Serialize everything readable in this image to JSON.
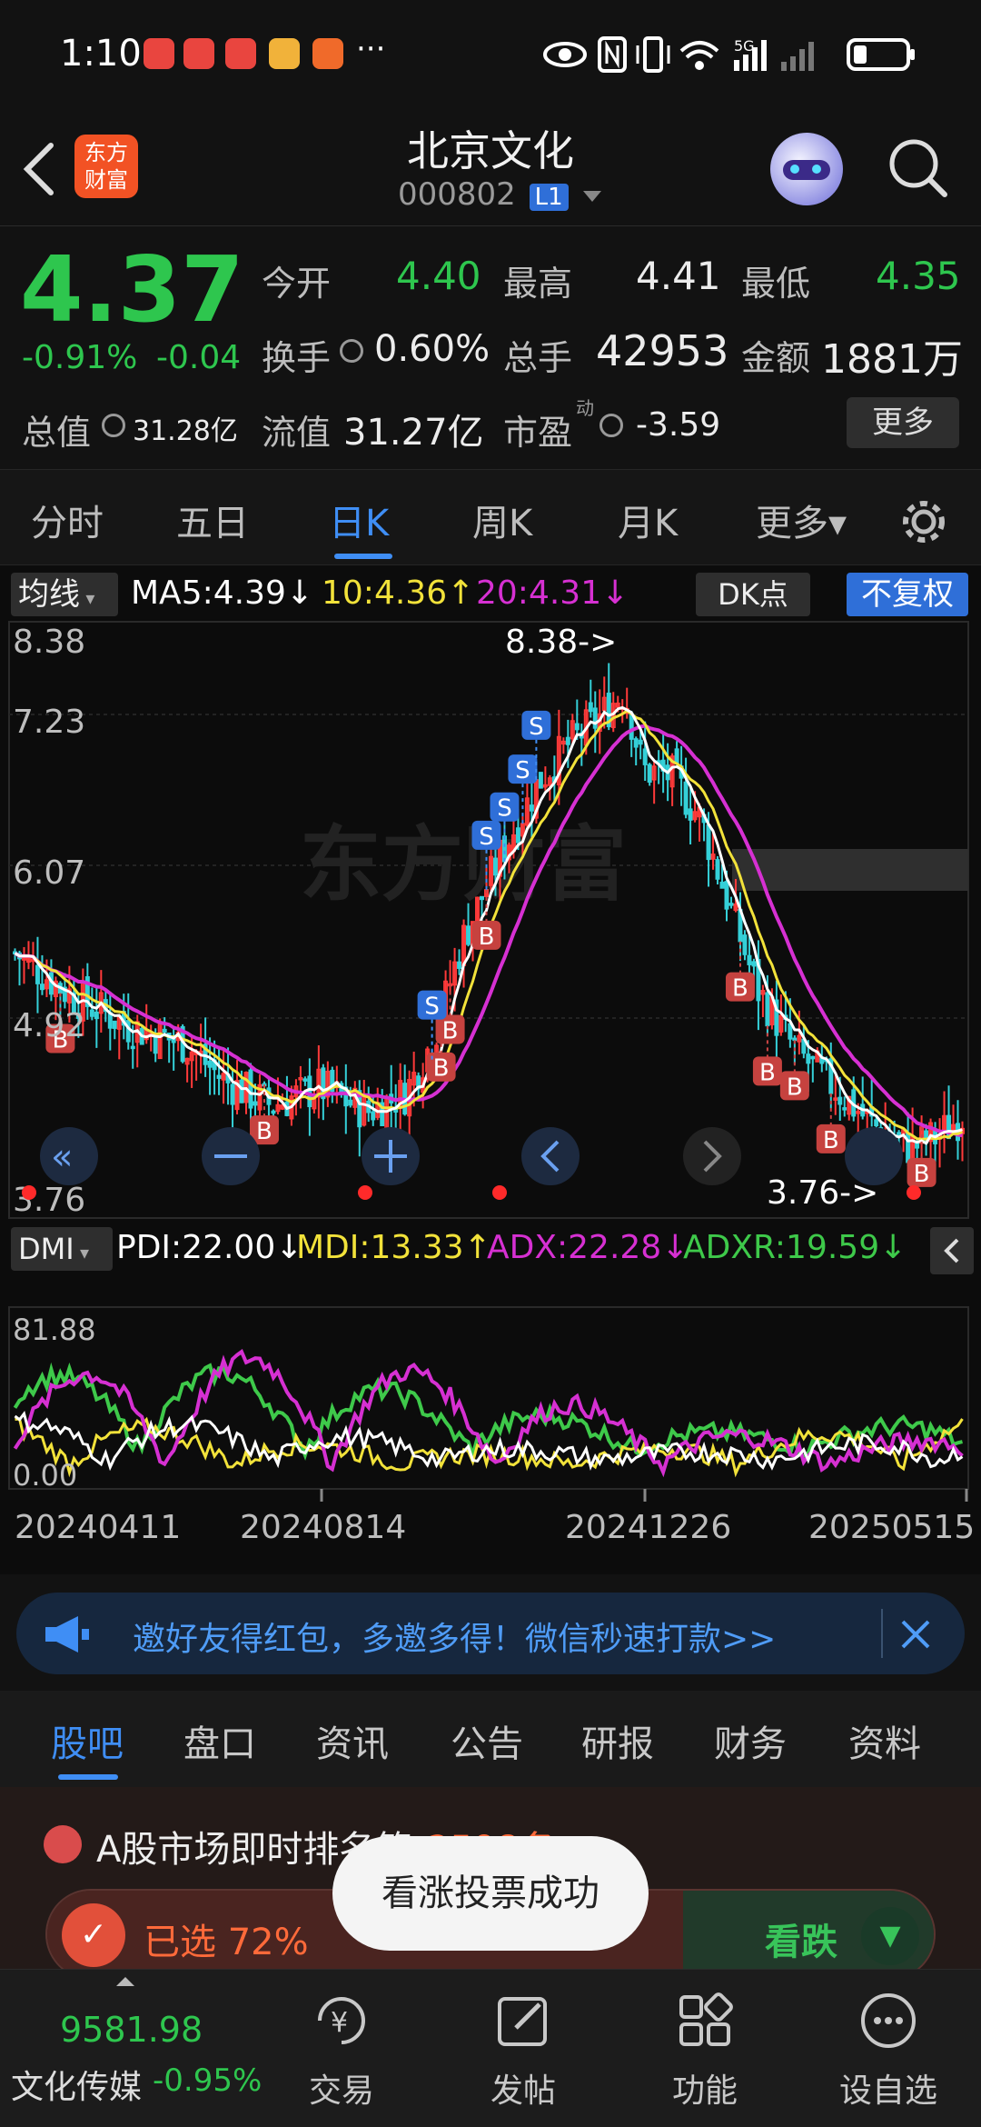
{
  "status_bar": {
    "time": "1:10",
    "more": "···",
    "network": "5G"
  },
  "header": {
    "title": "北京文化",
    "code": "000802",
    "level_badge": "L1",
    "logo_text": "东方财富"
  },
  "quote": {
    "price": "4.37",
    "change_pct": "-0.91%",
    "change": "-0.04",
    "open_label": "今开",
    "open": "4.40",
    "high_label": "最高",
    "high": "4.41",
    "low_label": "最低",
    "low": "4.35",
    "turnover_label": "换手",
    "turnover": "0.60%",
    "volume_label": "总手",
    "volume": "42953",
    "amount_label": "金额",
    "amount": "1881万",
    "mktcap_label": "总值",
    "mktcap": "31.28亿",
    "float_label": "流值",
    "float_cap": "31.27亿",
    "pe_label": "市盈",
    "pe_sup": "动",
    "pe": "-3.59",
    "more_btn": "更多"
  },
  "chart_tabs": [
    {
      "label": "分时"
    },
    {
      "label": "五日"
    },
    {
      "label": "日K"
    },
    {
      "label": "周K"
    },
    {
      "label": "月K"
    },
    {
      "label": "更多▾"
    }
  ],
  "chart_tabs_active": "日K",
  "indicator_bar": {
    "selector": "均线",
    "ma5": "MA5:4.39↓",
    "ma10": "10:4.36↑",
    "ma20": "20:4.31↓",
    "dk_btn": "DK点",
    "adjust_btn": "不复权"
  },
  "kline": {
    "y_ticks": [
      "8.38",
      "7.23",
      "6.07",
      "4.92",
      "3.76"
    ],
    "max_label": "8.38->",
    "min_label": "3.76->",
    "watermark": "东方财富",
    "buy_marker": "B",
    "sell_marker": "S"
  },
  "dmi_bar": {
    "selector": "DMI",
    "pdi": "PDI:22.00↓",
    "mdi": "MDI:13.33↑",
    "adx": "ADX:22.28↓",
    "adxr": "ADXR:19.59↓",
    "y_max": "81.88",
    "y_min": "0.00"
  },
  "x_dates": [
    "20240411",
    "20240814",
    "20241226",
    "20250515"
  ],
  "colors": {
    "up": "#ff3a3a",
    "down": "#2ec64e",
    "accent": "#3f8ef5",
    "ma5": "#ffffff",
    "ma10": "#f2e23a",
    "ma20": "#d630d2",
    "adxr": "#3ec94a"
  },
  "banner": {
    "text": "邀好友得红包，多邀多得！微信秒速打款>>"
  },
  "bottom_tabs": [
    {
      "label": "股吧"
    },
    {
      "label": "盘口"
    },
    {
      "label": "资讯"
    },
    {
      "label": "公告"
    },
    {
      "label": "研报"
    },
    {
      "label": "财务"
    },
    {
      "label": "资料"
    }
  ],
  "bottom_tabs_active": "股吧",
  "feed": {
    "rank_text": "A股市场即时排名第",
    "rank_hidden": "2598名",
    "selected": "已选 72%",
    "fall_btn": "看跌"
  },
  "toast": "看涨投票成功",
  "nav": {
    "index_value": "9581.98",
    "index_name": "文化传媒",
    "index_change": "-0.95%",
    "items": [
      {
        "label": "交易"
      },
      {
        "label": "发帖"
      },
      {
        "label": "功能"
      },
      {
        "label": "设自选"
      }
    ]
  }
}
